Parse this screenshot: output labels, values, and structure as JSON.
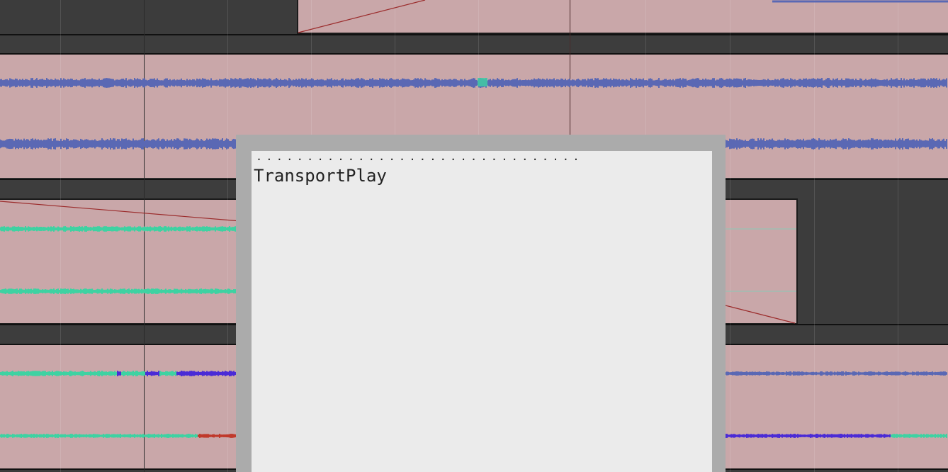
{
  "popup": {
    "dots": "................................",
    "title": "TransportPlay"
  },
  "colors": {
    "background": "#3c3c3c",
    "clip_fill": "#c9a7a9",
    "waveform_blue": "#5a68b4",
    "waveform_green": "#3ed2a2",
    "waveform_violet": "#4a2bd6",
    "waveform_red": "#c0392b",
    "envelope_line": "#9b2c2c",
    "popup_frame": "#ababab",
    "popup_body": "#ebebeb"
  },
  "icons": {
    "popup_handle": "dotted-drag-handle-icon"
  }
}
